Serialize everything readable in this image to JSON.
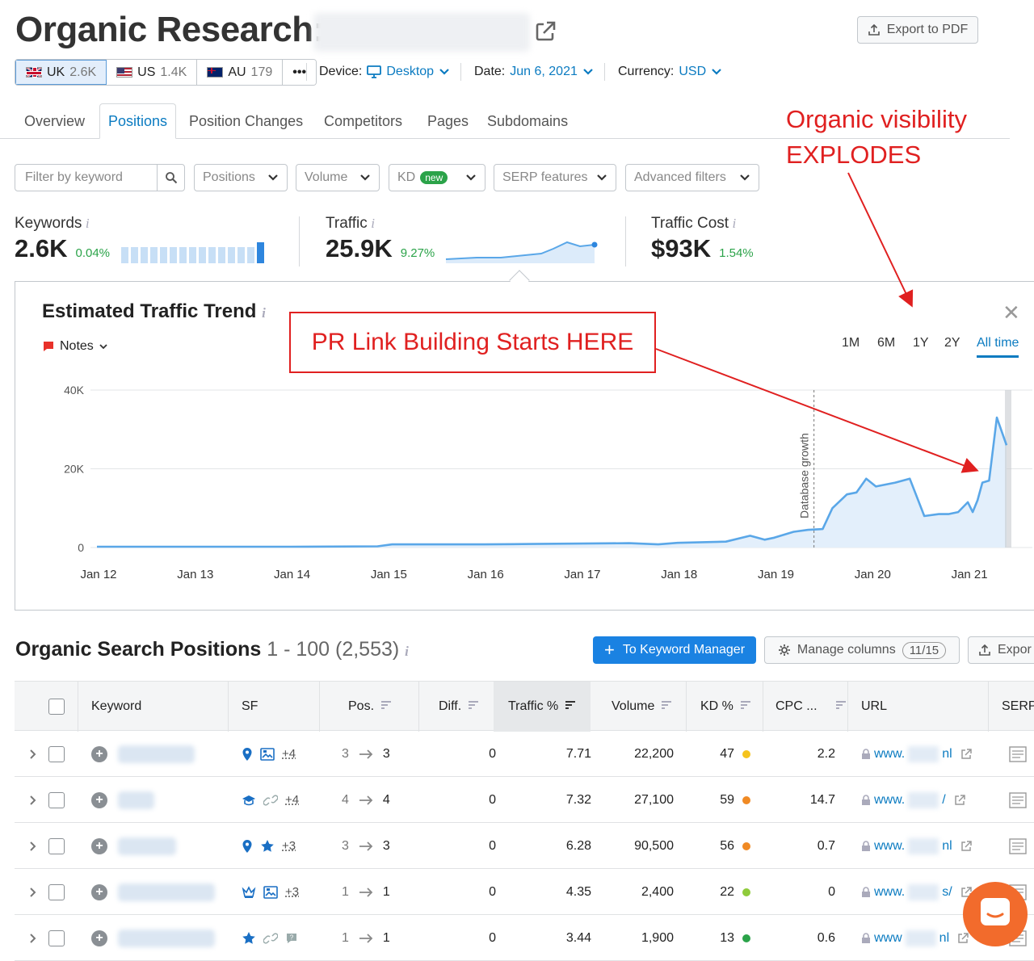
{
  "header": {
    "title": "Organic Research:",
    "export_label": "Export to PDF"
  },
  "databases": [
    {
      "code": "UK",
      "count": "2.6K"
    },
    {
      "code": "US",
      "count": "1.4K"
    },
    {
      "code": "AU",
      "count": "179"
    }
  ],
  "more_label": "•••",
  "selectors": {
    "device_label": "Device:",
    "device_value": "Desktop",
    "date_label": "Date:",
    "date_value": "Jun 6, 2021",
    "currency_label": "Currency:",
    "currency_value": "USD"
  },
  "tabs": [
    "Overview",
    "Positions",
    "Position Changes",
    "Competitors",
    "Pages",
    "Subdomains"
  ],
  "active_tab": "Positions",
  "annotations": {
    "visibility_line1": "Organic visibility",
    "visibility_line2": "EXPLODES",
    "pr_box": "PR Link Building Starts HERE"
  },
  "filters": {
    "keyword_placeholder": "Filter by keyword",
    "positions": "Positions",
    "volume": "Volume",
    "kd": "KD",
    "kd_badge": "new",
    "serp": "SERP features",
    "advanced": "Advanced filters"
  },
  "metrics": {
    "keywords": {
      "label": "Keywords",
      "value": "2.6K",
      "change": "0.04%"
    },
    "traffic": {
      "label": "Traffic",
      "value": "25.9K",
      "change": "9.27%"
    },
    "traffic_cost": {
      "label": "Traffic Cost",
      "value": "$93K",
      "change": "1.54%"
    }
  },
  "trend": {
    "title": "Estimated Traffic Trend",
    "notes_label": "Notes",
    "periods": [
      "1M",
      "6M",
      "1Y",
      "2Y",
      "All time"
    ],
    "active_period": "All time",
    "marker_label": "Database growth",
    "close_label": "✕"
  },
  "chart_data": {
    "type": "area",
    "title": "",
    "x_ticks": [
      "Jan 12",
      "Jan 13",
      "Jan 14",
      "Jan 15",
      "Jan 16",
      "Jan 17",
      "Jan 18",
      "Jan 19",
      "Jan 20",
      "Jan 21"
    ],
    "y_ticks": [
      "0",
      "20K",
      "40K"
    ],
    "ylim": [
      0,
      40000
    ],
    "xlim": [
      2012.0,
      2021.45
    ],
    "grid": true,
    "series": [
      {
        "x": [
          2012.0,
          2013.0,
          2014.0,
          2014.9,
          2015.05,
          2015.5,
          2016.0,
          2016.5,
          2017.0,
          2017.5,
          2017.8,
          2018.0,
          2018.5,
          2018.75,
          2018.9,
          2019.0,
          2019.2,
          2019.35,
          2019.5,
          2019.6,
          2019.75,
          2019.85,
          2019.95,
          2020.05,
          2020.15,
          2020.25,
          2020.4,
          2020.55,
          2020.7,
          2020.8,
          2020.9,
          2021.0,
          2021.05,
          2021.1,
          2021.15,
          2021.22,
          2021.3,
          2021.4
        ],
        "y": [
          200,
          200,
          200,
          300,
          800,
          800,
          800,
          900,
          1000,
          1100,
          800,
          1200,
          1500,
          3000,
          2000,
          2500,
          4000,
          4500,
          4700,
          10000,
          13500,
          14000,
          17500,
          15500,
          16000,
          16500,
          17500,
          8000,
          8500,
          8500,
          9000,
          11500,
          9000,
          12000,
          16500,
          17000,
          33000,
          26000
        ]
      }
    ]
  },
  "table": {
    "title": "Organic Search Positions",
    "range": "1 - 100 (2,553)",
    "to_km_label": "To Keyword Manager",
    "manage_label": "Manage columns",
    "manage_count": "11/15",
    "export_label": "Expor",
    "headers": [
      "Keyword",
      "SF",
      "Pos.",
      "Diff.",
      "Traffic %",
      "Volume",
      "KD %",
      "CPC ...",
      "URL",
      "SERP"
    ],
    "rows": [
      {
        "sf": [
          "pin",
          "image"
        ],
        "sf_more": "+4",
        "pos_from": "3",
        "pos_to": "3",
        "diff": "0",
        "traffic": "7.71",
        "volume": "22,200",
        "kd": "47",
        "kd_color": "#f5c31d",
        "cpc": "2.2",
        "url_a": "www.",
        "url_b": "nl"
      },
      {
        "sf": [
          "cap",
          "link"
        ],
        "sf_more": "+4",
        "pos_from": "4",
        "pos_to": "4",
        "diff": "0",
        "traffic": "7.32",
        "volume": "27,100",
        "kd": "59",
        "kd_color": "#f08a24",
        "cpc": "14.7",
        "url_a": "www.",
        "url_b": "/"
      },
      {
        "sf": [
          "pin",
          "star"
        ],
        "sf_more": "+3",
        "pos_from": "3",
        "pos_to": "3",
        "diff": "0",
        "traffic": "6.28",
        "volume": "90,500",
        "kd": "56",
        "kd_color": "#f08a24",
        "cpc": "0.7",
        "url_a": "www.",
        "url_b": "nl"
      },
      {
        "sf": [
          "crown",
          "image"
        ],
        "sf_more": "+3",
        "pos_from": "1",
        "pos_to": "1",
        "diff": "0",
        "traffic": "4.35",
        "volume": "2,400",
        "kd": "22",
        "kd_color": "#8fcb3b",
        "cpc": "0",
        "url_a": "www.",
        "url_b": "s/"
      },
      {
        "sf": [
          "star",
          "link",
          "faq"
        ],
        "sf_more": "",
        "pos_from": "1",
        "pos_to": "1",
        "diff": "0",
        "traffic": "3.44",
        "volume": "1,900",
        "kd": "13",
        "kd_color": "#2ba349",
        "cpc": "0.6",
        "url_a": "www",
        "url_b": "nl"
      }
    ]
  }
}
